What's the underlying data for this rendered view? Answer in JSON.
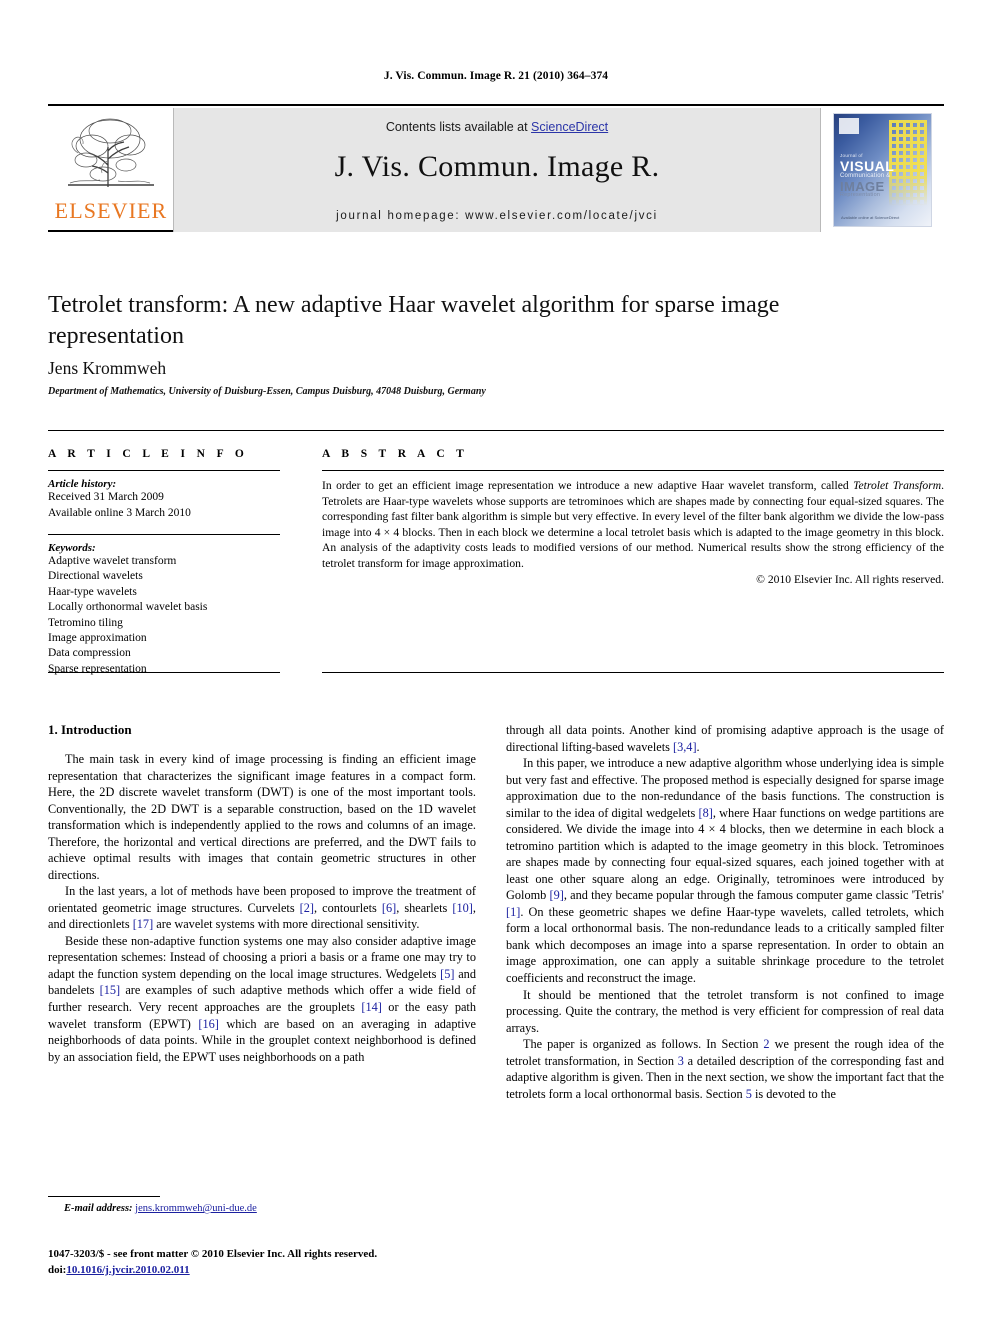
{
  "running_head": "J. Vis. Commun. Image R. 21 (2010) 364–374",
  "masthead": {
    "publisher_name": "ELSEVIER",
    "contents_prefix": "Contents lists available at ",
    "sciencedirect": "ScienceDirect",
    "journal_title": "J. Vis. Commun. Image R.",
    "homepage": "journal homepage: www.elsevier.com/locate/jvci",
    "cover": {
      "line1": "Journal of",
      "line2": "VISUAL",
      "line3": "Communication &",
      "line4": "IMAGE",
      "line5": "Representation",
      "footer": "Available online at ScienceDirect"
    },
    "colors": {
      "band_background": "#e6e6e6",
      "link": "#2b35a8",
      "elsevier_orange": "#E87722",
      "cover_blue": "#27407e",
      "cover_yellow": "#f4e04a"
    }
  },
  "article": {
    "title": "Tetrolet transform: A new adaptive Haar wavelet algorithm for sparse image representation",
    "author": "Jens Krommweh",
    "affiliation": "Department of Mathematics, University of Duisburg-Essen, Campus Duisburg, 47048 Duisburg, Germany"
  },
  "info": {
    "heading": "A R T I C L E   I N F O",
    "history_label": "Article history:",
    "history": [
      "Received 31 March 2009",
      "Available online 3 March 2010"
    ],
    "keywords_label": "Keywords:",
    "keywords": [
      "Adaptive wavelet transform",
      "Directional wavelets",
      "Haar-type wavelets",
      "Locally orthonormal wavelet basis",
      "Tetromino tiling",
      "Image approximation",
      "Data compression",
      "Sparse representation"
    ]
  },
  "abstract": {
    "heading": "A B S T R A C T",
    "part1": "In order to get an efficient image representation we introduce a new adaptive Haar wavelet transform, called ",
    "emphasis": "Tetrolet Transform",
    "part2": ". Tetrolets are Haar-type wavelets whose supports are tetrominoes which are shapes made by connecting four equal-sized squares. The corresponding fast filter bank algorithm is simple but very effective. In every level of the filter bank algorithm we divide the low-pass image into 4 × 4 blocks. Then in each block we determine a local tetrolet basis which is adapted to the image geometry in this block. An analysis of the adaptivity costs leads to modified versions of our method. Numerical results show the strong efficiency of the tetrolet transform for image approximation.",
    "copyright": "© 2010 Elsevier Inc. All rights reserved."
  },
  "body": {
    "section_heading": "1. Introduction",
    "left": {
      "p1": "The main task in every kind of image processing is finding an efficient image representation that characterizes the significant image features in a compact form. Here, the 2D discrete wavelet transform (DWT) is one of the most important tools. Conventionally, the 2D DWT is a separable construction, based on the 1D wavelet transformation which is independently applied to the rows and columns of an image. Therefore, the horizontal and vertical directions are preferred, and the DWT fails to achieve optimal results with images that contain geometric structures in other directions.",
      "p2_a": "In the last years, a lot of methods have been proposed to improve the treatment of orientated geometric image structures. Curvelets ",
      "p2_c1": "[2]",
      "p2_b": ", contourlets ",
      "p2_c2": "[6]",
      "p2_d": ", shearlets ",
      "p2_c3": "[10]",
      "p2_e": ", and directionlets ",
      "p2_c4": "[17]",
      "p2_f": " are wavelet systems with more directional sensitivity.",
      "p3_a": "Beside these non-adaptive function systems one may also consider adaptive image representation schemes: Instead of choosing a priori a basis or a frame one may try to adapt the function system depending on the local image structures. Wedgelets ",
      "p3_c1": "[5]",
      "p3_b": " and bandelets ",
      "p3_c2": "[15]",
      "p3_c": " are examples of such adaptive methods which offer a wide field of further research. Very recent approaches are the grouplets ",
      "p3_c3": "[14]",
      "p3_d": " or the easy path wavelet transform (EPWT) ",
      "p3_c4": "[16]",
      "p3_e": " which are based on an averaging in adaptive neighborhoods of data points. While in the grouplet context neighborhood is defined by an association field, the EPWT uses neighborhoods on a path"
    },
    "right": {
      "p1_a": "through all data points. Another kind of promising adaptive approach is the usage of directional lifting-based wavelets ",
      "p1_c1": "[3,4]",
      "p1_b": ".",
      "p2_a": "In this paper, we introduce a new adaptive algorithm whose underlying idea is simple but very fast and effective. The proposed method is especially designed for sparse image approximation due to the non-redundance of the basis functions. The construction is similar to the idea of digital wedgelets ",
      "p2_c1": "[8]",
      "p2_b": ", where Haar functions on wedge partitions are considered. We divide the image into 4 × 4 blocks, then we determine in each block a tetromino partition which is adapted to the image geometry in this block. Tetrominoes are shapes made by connecting four equal-sized squares, each joined together with at least one other square along an edge. Originally, tetrominoes were introduced by Golomb ",
      "p2_c2": "[9]",
      "p2_c": ", and they became popular through the famous computer game classic 'Tetris' ",
      "p2_c3": "[1]",
      "p2_d": ". On these geometric shapes we define Haar-type wavelets, called tetrolets, which form a local orthonormal basis. The non-redundance leads to a critically sampled filter bank which decomposes an image into a sparse representation. In order to obtain an image approximation, one can apply a suitable shrinkage procedure to the tetrolet coefficients and reconstruct the image.",
      "p3": "It should be mentioned that the tetrolet transform is not confined to image processing. Quite the contrary, the method is very efficient for compression of real data arrays.",
      "p4_a": "The paper is organized as follows. In Section ",
      "p4_c1": "2",
      "p4_b": " we present the rough idea of the tetrolet transformation, in Section ",
      "p4_c2": "3",
      "p4_c": " a detailed description of the corresponding fast and adaptive algorithm is given. Then in the next section, we show the important fact that the tetrolets form a local orthonormal basis. Section ",
      "p4_c3": "5",
      "p4_d": " is devoted to the"
    }
  },
  "footer": {
    "email_label": "E-mail address:",
    "email": "jens.krommweh@uni-due.de",
    "issn_line": "1047-3203/$ - see front matter © 2010 Elsevier Inc. All rights reserved.",
    "doi_label": "doi:",
    "doi": "10.1016/j.jvcir.2010.02.011"
  }
}
